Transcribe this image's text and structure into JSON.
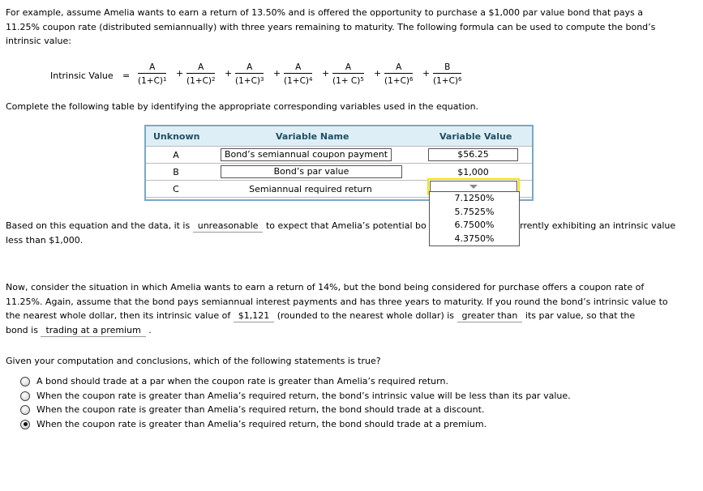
{
  "intro": {
    "line1": "For example, assume Amelia wants to earn a return of 13.50% and is offered the opportunity to purchase a $1,000 par value bond that pays a",
    "line2": "11.25% coupon rate (distributed semiannually) with three years remaining to maturity. The following formula can be used to compute the bond’s",
    "line3": "intrinsic value:"
  },
  "equation": {
    "label": "Intrinsic Value",
    "equals": "=",
    "plus": "+",
    "terms": [
      {
        "num": "A",
        "den": "(1+C)",
        "exp": "1"
      },
      {
        "num": "A",
        "den": "(1+C)",
        "exp": "2"
      },
      {
        "num": "A",
        "den": "(1+C)",
        "exp": "3"
      },
      {
        "num": "A",
        "den": "(1+C)",
        "exp": "4"
      },
      {
        "num": "A",
        "den": "(1+ C)",
        "exp": "5"
      },
      {
        "num": "A",
        "den": "(1+C)",
        "exp": "6"
      },
      {
        "num": "B",
        "den": "(1+C)",
        "exp": "6"
      }
    ]
  },
  "table_instruction": "Complete the following table by identifying the appropriate corresponding variables used in the equation.",
  "table": {
    "headers": [
      "Unknown",
      "Variable Name",
      "Variable Value"
    ],
    "rows": [
      {
        "unknown": "A",
        "name": "Bond’s semiannual coupon payment",
        "value": "$56.25"
      },
      {
        "unknown": "B",
        "name": "Bond’s par value",
        "value": "$1,000"
      },
      {
        "unknown": "C",
        "name": "Semiannual required return",
        "value": ""
      }
    ]
  },
  "dropdown": {
    "options": [
      "7.1250%",
      "5.7525%",
      "6.7500%",
      "4.3750%"
    ],
    "highlight_color": "#f2e600"
  },
  "reasoning": {
    "pre": "Based on this equation and the data, it is",
    "blank": "unreasonable",
    "mid": "to expect that Amelia’s potential bo",
    "post": "rrently exhibiting an intrinsic value",
    "line2": "less than $1,000."
  },
  "scenario": {
    "line1": "Now, consider the situation in which Amelia wants to earn a return of 14%, but the bond being considered for purchase offers a coupon rate of",
    "line2": "11.25%. Again, assume that the bond pays semiannual interest payments and has three years to maturity. If you round the bond’s intrinsic value to",
    "line3_pre": "the nearest whole dollar, then its intrinsic value of",
    "blank_value": "$1,121",
    "line3_mid": "(rounded to the nearest whole dollar) is",
    "blank_compare": "greater than",
    "line3_post": "its par value, so that the",
    "line4_pre": "bond is",
    "blank_status": "trading at a premium",
    "line4_post": "."
  },
  "question": "Given your computation and conclusions, which of the following statements is true?",
  "options": [
    {
      "text": "A bond should trade at a par when the coupon rate is greater than Amelia’s required return.",
      "selected": false
    },
    {
      "text": "When the coupon rate is greater than Amelia’s required return, the bond’s intrinsic value will be less than its par value.",
      "selected": false
    },
    {
      "text": "When the coupon rate is greater than Amelia’s required return, the bond should trade at a discount.",
      "selected": false
    },
    {
      "text": "When the coupon rate is greater than Amelia’s required return, the bond should trade at a premium.",
      "selected": true
    }
  ]
}
